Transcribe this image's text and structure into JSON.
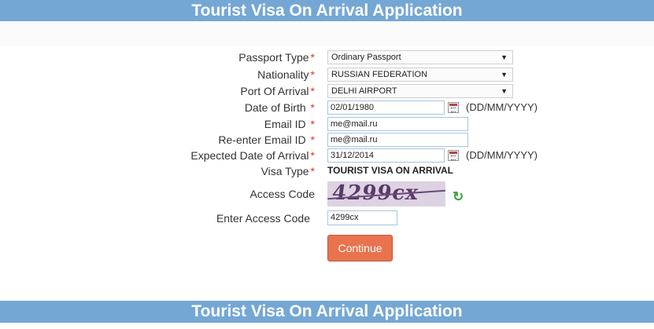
{
  "header": {
    "title": "Tourist Visa On Arrival Application"
  },
  "footer": {
    "title": "Tourist Visa On Arrival Application"
  },
  "form": {
    "passport_type": {
      "label": "Passport Type",
      "value": "Ordinary Passport"
    },
    "nationality": {
      "label": "Nationality",
      "value": "RUSSIAN FEDERATION"
    },
    "port_of_arrival": {
      "label": "Port Of Arrival",
      "value": "DELHI AIRPORT"
    },
    "date_of_birth": {
      "label": "Date of Birth",
      "value": "02/01/1980",
      "hint": "(DD/MM/YYYY)"
    },
    "email": {
      "label": "Email ID",
      "value": "me@mail.ru"
    },
    "email_confirm": {
      "label": "Re-enter Email ID",
      "value": "me@mail.ru"
    },
    "expected_arrival": {
      "label": "Expected Date of Arrival",
      "value": "31/12/2014",
      "hint": "(DD/MM/YYYY)"
    },
    "visa_type": {
      "label": "Visa Type",
      "value": "TOURIST VISA ON ARRIVAL"
    },
    "access_code": {
      "label": "Access Code",
      "captcha_text": "4299cx"
    },
    "enter_access_code": {
      "label": "Enter Access Code",
      "value": "4299cx"
    },
    "required_mark": "*",
    "continue_label": "Continue"
  },
  "icons": {
    "dropdown": "chevron-down-icon",
    "calendar": "calendar-icon",
    "refresh": "refresh-icon"
  },
  "colors": {
    "banner": "#74a7d4",
    "required": "#e0312b",
    "button": "#e8734e",
    "refresh": "#3aa23a"
  }
}
